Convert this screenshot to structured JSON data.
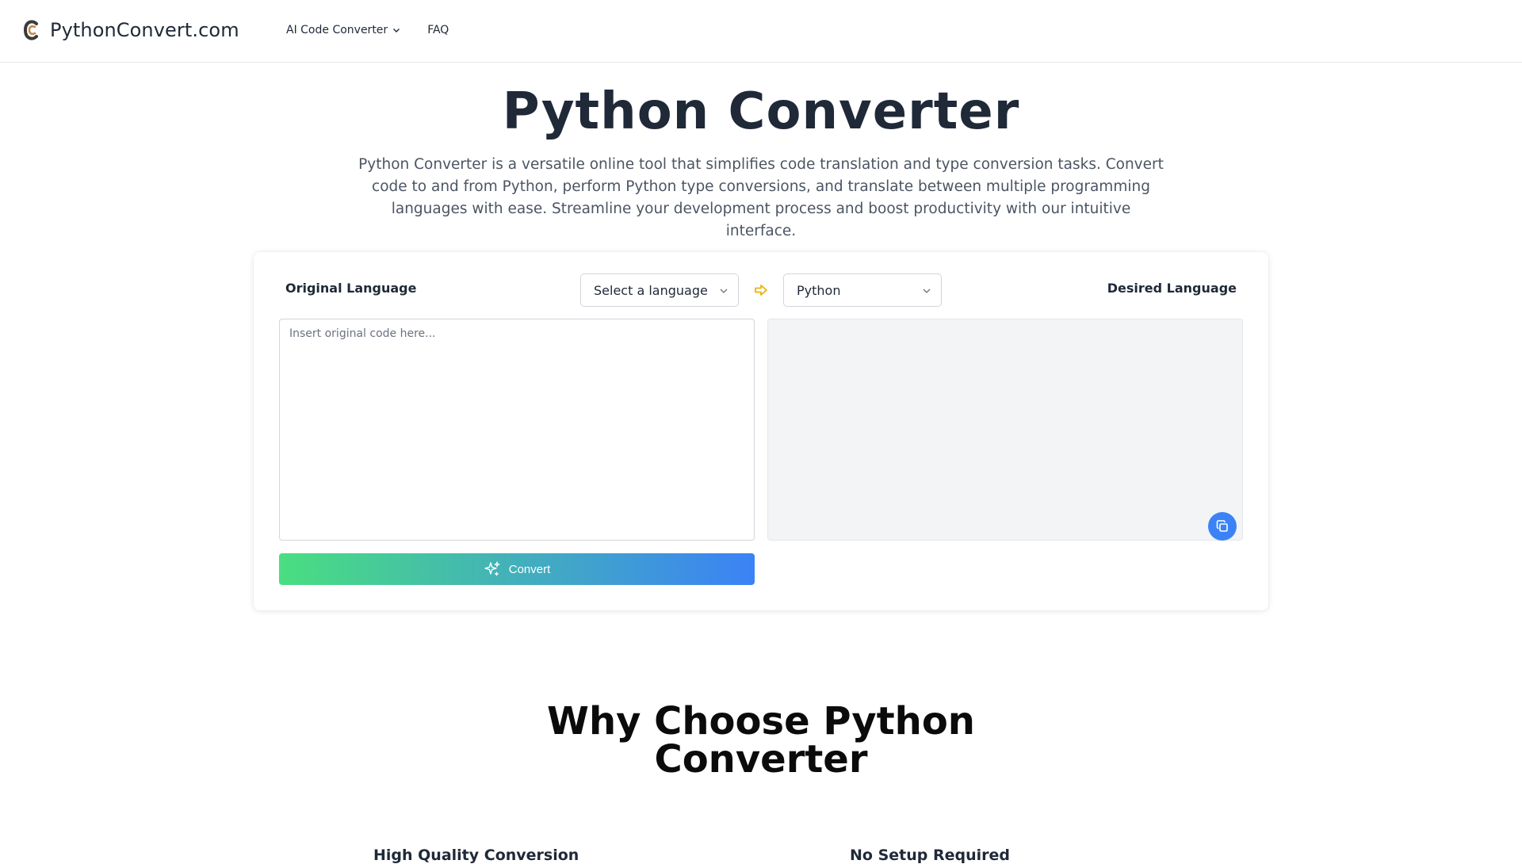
{
  "brand": {
    "name": "PythonConvert.com"
  },
  "nav": {
    "items": [
      {
        "label": "AI Code Converter",
        "has_dropdown": true
      },
      {
        "label": "FAQ",
        "has_dropdown": false
      }
    ]
  },
  "hero": {
    "title": "Python Converter",
    "description": "Python Converter is a versatile online tool that simplifies code translation and type conversion tasks. Convert code to and from Python, perform Python type conversions, and translate between multiple programming languages with ease. Streamline your development process and boost productivity with our intuitive interface."
  },
  "converter": {
    "original_label": "Original Language",
    "desired_label": "Desired Language",
    "source_select": {
      "value": "Select a language"
    },
    "target_select": {
      "value": "Python"
    },
    "input": {
      "placeholder": "Insert original code here...",
      "value": ""
    },
    "output": {
      "value": ""
    },
    "convert_label": "Convert",
    "icons": {
      "swap": "arrow-right-icon",
      "copy": "copy-icon",
      "convert": "sparkles-icon"
    }
  },
  "why": {
    "title_line1": "Why Choose Python",
    "title_line2": "Converter",
    "features": [
      {
        "title": "High Quality Conversion"
      },
      {
        "title": "No Setup Required"
      }
    ]
  },
  "colors": {
    "accent_blue": "#3b82f6",
    "gradient_start": "#4ade80",
    "gradient_end": "#3b82f6",
    "arrow_amber": "#eab308",
    "text_dark": "#1f2937"
  }
}
